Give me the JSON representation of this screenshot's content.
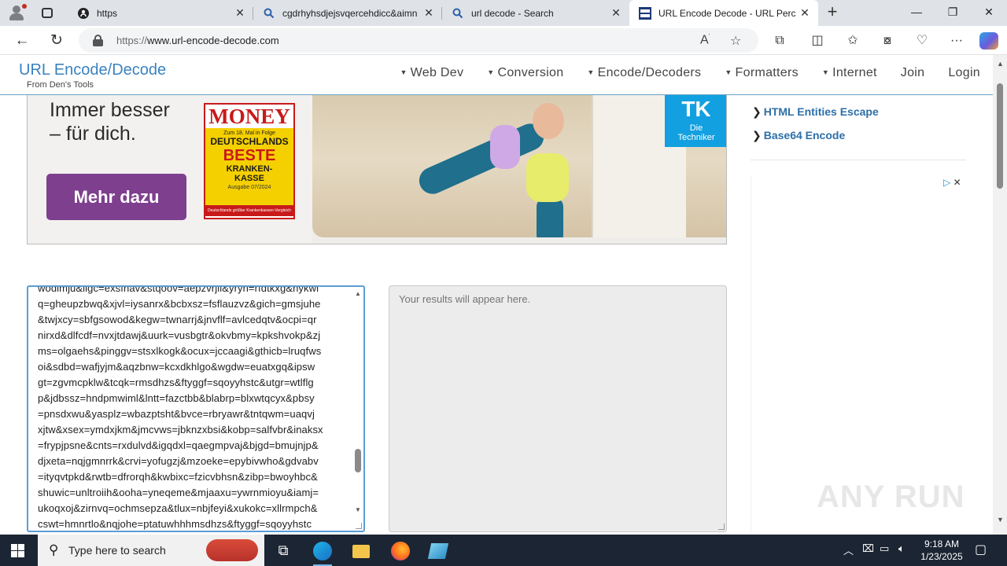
{
  "browser": {
    "tabs": [
      {
        "title": "https",
        "favicon": "github-icon",
        "active": false
      },
      {
        "title": "cgdrhyhsdjejsvqercehdicc&aimn",
        "favicon": "search-icon",
        "active": false
      },
      {
        "title": "url decode - Search",
        "favicon": "search-icon",
        "active": false
      },
      {
        "title": "URL Encode Decode - URL Percen",
        "favicon": "site-favicon",
        "active": true
      }
    ],
    "url_protocol": "https://",
    "url_host": "www.url-encode-decode.com"
  },
  "site": {
    "brand": "URL Encode/Decode",
    "brand_sub": "From Den's Tools",
    "nav": [
      {
        "label": "Web Dev",
        "dropdown": true
      },
      {
        "label": "Conversion",
        "dropdown": true
      },
      {
        "label": "Encode/Decoders",
        "dropdown": true
      },
      {
        "label": "Formatters",
        "dropdown": true
      },
      {
        "label": "Internet",
        "dropdown": true
      },
      {
        "label": "Join",
        "dropdown": false
      },
      {
        "label": "Login",
        "dropdown": false
      }
    ]
  },
  "ad": {
    "headline_1": "Immer besser",
    "headline_2": "– für dich.",
    "cta": "Mehr dazu",
    "badge_brand": "MONEY",
    "badge_line1": "Zum 18. Mal in Folge",
    "badge_line2": "DEUTSCHLANDS",
    "badge_line3": "BESTE",
    "badge_line4": "KRANKEN-",
    "badge_line5": "KASSE",
    "badge_issue": "Ausgabe 07/2024",
    "badge_footer": "Deutschlands größter Krankenkassen-Vergleich",
    "advertiser_line1": "Die",
    "advertiser_line2": "Techniker"
  },
  "sidebar": {
    "links": [
      "HTML Entities Escape",
      "Base64 Encode"
    ]
  },
  "tool": {
    "input_lines": [
      "wodimju&ligc=exsfnav&stqoov=aepzvrjil&yryn=rfdtkxg&nykwl",
      "q=gheupzbwq&xjvl=iysanrx&bcbxsz=fsflauzvz&gich=gmsjuhe",
      "&twjxcy=sbfgsowod&kegw=twnarrj&jnvflf=avlcedqtv&ocpi=qr",
      "nirxd&dlfcdf=nvxjtdawj&uurk=vusbgtr&okvbmy=kpkshvokp&zj",
      "ms=olgaehs&pinggv=stsxlkogk&ocux=jccaagi&gthicb=lruqfws",
      "oi&sdbd=wafjyjm&aqzbnw=kcxdkhlgo&wgdw=euatxgq&ipsw",
      "gt=zgvmcpklw&tcqk=rmsdhzs&ftyggf=sqoyyhstc&utgr=wtlflg",
      "p&jdbssz=hndpmwiml&lntt=fazctbb&blabrp=blxwtqcyx&pbsy",
      "=pnsdxwu&yasplz=wbazptsht&bvce=rbryawr&tntqwm=uaqvj",
      "xjtw&xsex=ymdxjkm&jmcvws=jbknzxbsi&kobp=salfvbr&inaksx",
      "=frypjpsne&cnts=rxdulvd&igqdxl=qaegmpvaj&bjgd=bmujnjp&",
      "djxeta=nqjgmnrrk&crvi=yofugzj&mzoeke=epybivwho&gdvabv",
      "=ityqvtpkd&rwtb=dfrorqh&kwbixc=fzicvbhsn&zibp=bwoyhbc&",
      "shuwic=unltroiih&ooha=yneqeme&mjaaxu=ywrnmioyu&iamj=",
      "ukoqxoj&zirnvq=ochmsepza&tlux=nbjfeyi&xukokc=xllrmpch&",
      "cswt=hmnrtlo&nqjohe=ptatuwhhhmsdhzs&ftyggf=sqoyyhstc"
    ],
    "output_placeholder": "Your results will appear here."
  },
  "watermark": "ANY RUN",
  "taskbar": {
    "search_placeholder": "Type here to search",
    "time": "9:18 AM",
    "date": "1/23/2025"
  }
}
